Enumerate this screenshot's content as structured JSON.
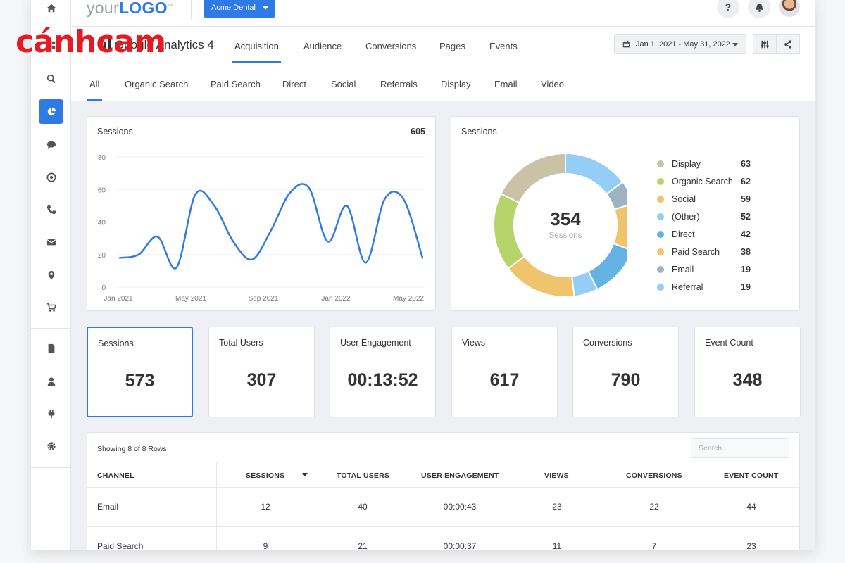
{
  "topbar": {
    "logo_prefix": "your",
    "logo_main": "LOGO",
    "logo_tm": "™",
    "client_name": "Acme Dental",
    "help_label": "?"
  },
  "watermark": {
    "text": "cánhcam"
  },
  "nav": {
    "page_title": "Google Analytics 4",
    "tabs": [
      "Acquisition",
      "Audience",
      "Conversions",
      "Pages",
      "Events"
    ],
    "active_tab": "Acquisition",
    "date_range": "Jan 1, 2021 - May 31, 2022"
  },
  "filters": {
    "items": [
      "All",
      "Organic Search",
      "Paid Search",
      "Direct",
      "Social",
      "Referrals",
      "Display",
      "Email",
      "Video"
    ],
    "active": "All"
  },
  "line_card": {
    "title": "Sessions",
    "total": "605"
  },
  "donut_card": {
    "title": "Sessions",
    "center_value": "354",
    "center_label": "Sessions"
  },
  "kpis": [
    {
      "label": "Sessions",
      "value": "573",
      "selected": true
    },
    {
      "label": "Total Users",
      "value": "307"
    },
    {
      "label": "User Engagement",
      "value": "00:13:52"
    },
    {
      "label": "Views",
      "value": "617"
    },
    {
      "label": "Conversions",
      "value": "790"
    },
    {
      "label": "Event Count",
      "value": "348"
    }
  ],
  "table": {
    "rows_info": "Showing 8 of 8 Rows",
    "search_placeholder": "Search",
    "columns": [
      "CHANNEL",
      "SESSIONS",
      "TOTAL USERS",
      "USER ENGAGEMENT",
      "VIEWS",
      "CONVERSIONS",
      "EVENT COUNT"
    ],
    "rows": [
      [
        "Email",
        "12",
        "40",
        "00:00:43",
        "23",
        "22",
        "44"
      ],
      [
        "Paid Search",
        "9",
        "21",
        "00:00:37",
        "11",
        "7",
        "23"
      ]
    ]
  },
  "chart_data": [
    {
      "type": "line",
      "title": "Sessions",
      "x_tick_labels": [
        "Jan 2021",
        "May 2021",
        "Sep 2021",
        "Jan 2022",
        "May 2022"
      ],
      "y_ticks": [
        0,
        20,
        40,
        60,
        80
      ],
      "ylim": [
        0,
        80
      ],
      "grid": true,
      "series": [
        {
          "color": "#2f7be5",
          "x": [
            0,
            1,
            2,
            3,
            4,
            5,
            6,
            7,
            8,
            9,
            10,
            11,
            12,
            13,
            14,
            15,
            16
          ],
          "values": [
            18,
            20,
            31,
            12,
            57,
            50,
            28,
            17,
            35,
            58,
            61,
            28,
            50,
            15,
            54,
            54,
            18
          ]
        }
      ]
    },
    {
      "type": "pie",
      "title": "Sessions",
      "donut": true,
      "slices": [
        {
          "label": "Display",
          "value": 63,
          "color": "#c9c2a6"
        },
        {
          "label": "Organic Search",
          "value": 62,
          "color": "#b5d56a"
        },
        {
          "label": "Social",
          "value": 59,
          "color": "#f0c36d"
        },
        {
          "label": "(Other)",
          "value": 52,
          "color": "#94cdf5"
        },
        {
          "label": "Direct",
          "value": 42,
          "color": "#65b3e2"
        },
        {
          "label": "Paid Search",
          "value": 38,
          "color": "#f0c36d"
        },
        {
          "label": "Email",
          "value": 19,
          "color": "#9bb3c3"
        },
        {
          "label": "Referral",
          "value": 19,
          "color": "#94cdf5"
        }
      ],
      "ring_order": [
        "(Other)",
        "Email",
        "Paid Search",
        "Direct",
        "Referral",
        "Social",
        "Organic Search",
        "Display"
      ]
    }
  ]
}
